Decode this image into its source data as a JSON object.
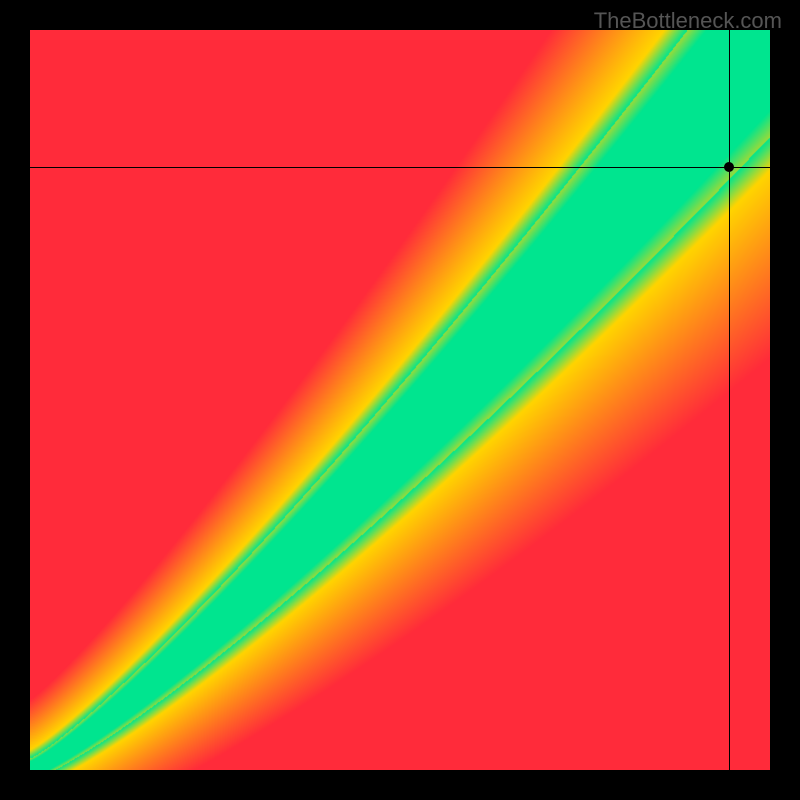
{
  "attribution": "TheBottleneck.com",
  "chart_data": {
    "type": "heatmap",
    "title": "",
    "xlabel": "",
    "ylabel": "",
    "xlim": [
      0,
      1
    ],
    "ylim": [
      0,
      1
    ],
    "marker": {
      "x": 0.945,
      "y": 0.815
    },
    "crosshairs": {
      "x": 0.945,
      "y": 0.815
    },
    "colors": {
      "low": "#ff2b3a",
      "mid_low": "#ffd400",
      "optimal": "#00e58f",
      "mid_high": "#ffd400",
      "high": "#ff2b3a"
    },
    "description": "Heatmap of bottleneck fit. Green diagonal band = balanced; red = heavy bottleneck. Band widens toward top-right. Marker placed near top-right on band edge."
  }
}
